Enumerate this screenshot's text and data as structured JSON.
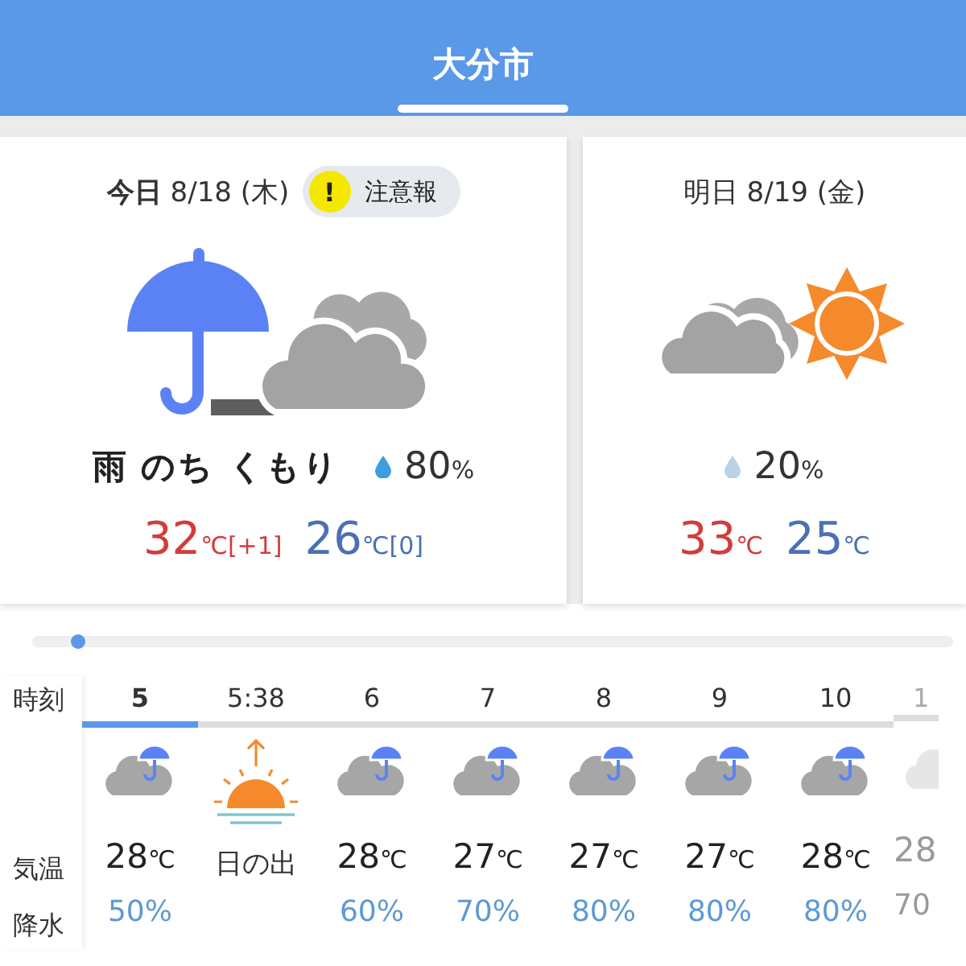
{
  "header": {
    "title": "大分市"
  },
  "days": [
    {
      "label": "今日",
      "date": "8/18",
      "weekday": "(木)",
      "label_bold": true,
      "warning": {
        "mark": "!",
        "text": "注意報"
      },
      "kind": "rainy",
      "forecast": "雨 のち くもり",
      "precip": "80",
      "precip_unit": "%",
      "high": {
        "value": "32",
        "unit": "℃",
        "diff": "[+1]"
      },
      "low": {
        "value": "26",
        "unit": "℃",
        "diff": "[0]"
      }
    },
    {
      "label": "明日",
      "date": "8/19",
      "weekday": "(金)",
      "label_bold": false,
      "kind": "sunny",
      "precip": "20",
      "precip_unit": "%",
      "high": {
        "value": "33",
        "unit": "℃"
      },
      "low": {
        "value": "25",
        "unit": "℃"
      }
    }
  ],
  "hourly": {
    "labels": {
      "time": "時刻",
      "temp": "気温",
      "precip": "降水"
    },
    "columns": [
      {
        "kind": "hour",
        "time": "5",
        "selected": true,
        "temp": "28",
        "unit": "℃",
        "precip": "50%",
        "faded": false
      },
      {
        "kind": "sunrise",
        "time": "5:38",
        "selected": false,
        "event": "日の出",
        "faded": false
      },
      {
        "kind": "hour",
        "time": "6",
        "selected": false,
        "temp": "28",
        "unit": "℃",
        "precip": "60%",
        "faded": false
      },
      {
        "kind": "hour",
        "time": "7",
        "selected": false,
        "temp": "27",
        "unit": "℃",
        "precip": "70%",
        "faded": false
      },
      {
        "kind": "hour",
        "time": "8",
        "selected": false,
        "temp": "27",
        "unit": "℃",
        "precip": "80%",
        "faded": false
      },
      {
        "kind": "hour",
        "time": "9",
        "selected": false,
        "temp": "27",
        "unit": "℃",
        "precip": "80%",
        "faded": false
      },
      {
        "kind": "hour",
        "time": "10",
        "selected": false,
        "temp": "28",
        "unit": "℃",
        "precip": "80%",
        "faded": false
      },
      {
        "kind": "hour",
        "time": "1",
        "selected": false,
        "temp": "28",
        "precip": "70",
        "faded": true
      }
    ]
  }
}
